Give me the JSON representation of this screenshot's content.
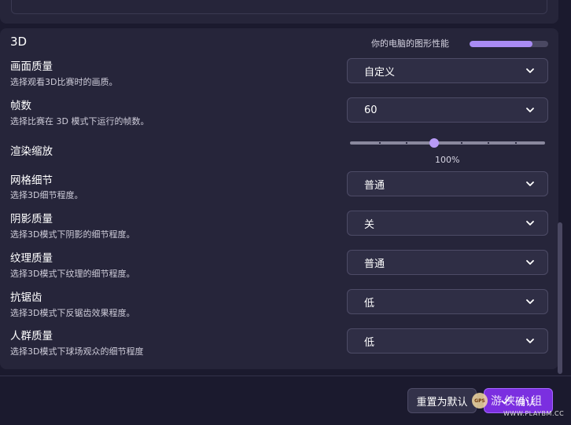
{
  "section": {
    "title": "3D"
  },
  "performance": {
    "label": "你的电脑的图形性能",
    "level_fraction": 0.8
  },
  "settings": [
    {
      "title": "画面质量",
      "desc": "选择观看3D比赛时的画质。",
      "value": "自定义"
    },
    {
      "title": "帧数",
      "desc": "选择比赛在 3D 模式下运行的帧数。",
      "value": "60"
    },
    {
      "title": "网格细节",
      "desc": "选择3D细节程度。",
      "value": "普通"
    },
    {
      "title": "阴影质量",
      "desc": "选择3D模式下阴影的细节程度。",
      "value": "关"
    },
    {
      "title": "纹理质量",
      "desc": "选择3D模式下纹理的细节程度。",
      "value": "普通"
    },
    {
      "title": "抗锯齿",
      "desc": "选择3D模式下反锯齿效果程度。",
      "value": "低"
    },
    {
      "title": "人群质量",
      "desc": "选择3D模式下球场观众的细节程度",
      "value": "低"
    }
  ],
  "render_scale": {
    "title": "渲染缩放",
    "value_label": "100%",
    "value_fraction": 0.43
  },
  "footer": {
    "reset_label": "重置为默认",
    "confirm_label": "确认"
  },
  "watermark": {
    "text": "游侠小组",
    "sub": "WWW.PLAYBM.CC"
  },
  "colors": {
    "accent": "#7b2fe0",
    "perf_fill": "#a98bf4"
  }
}
